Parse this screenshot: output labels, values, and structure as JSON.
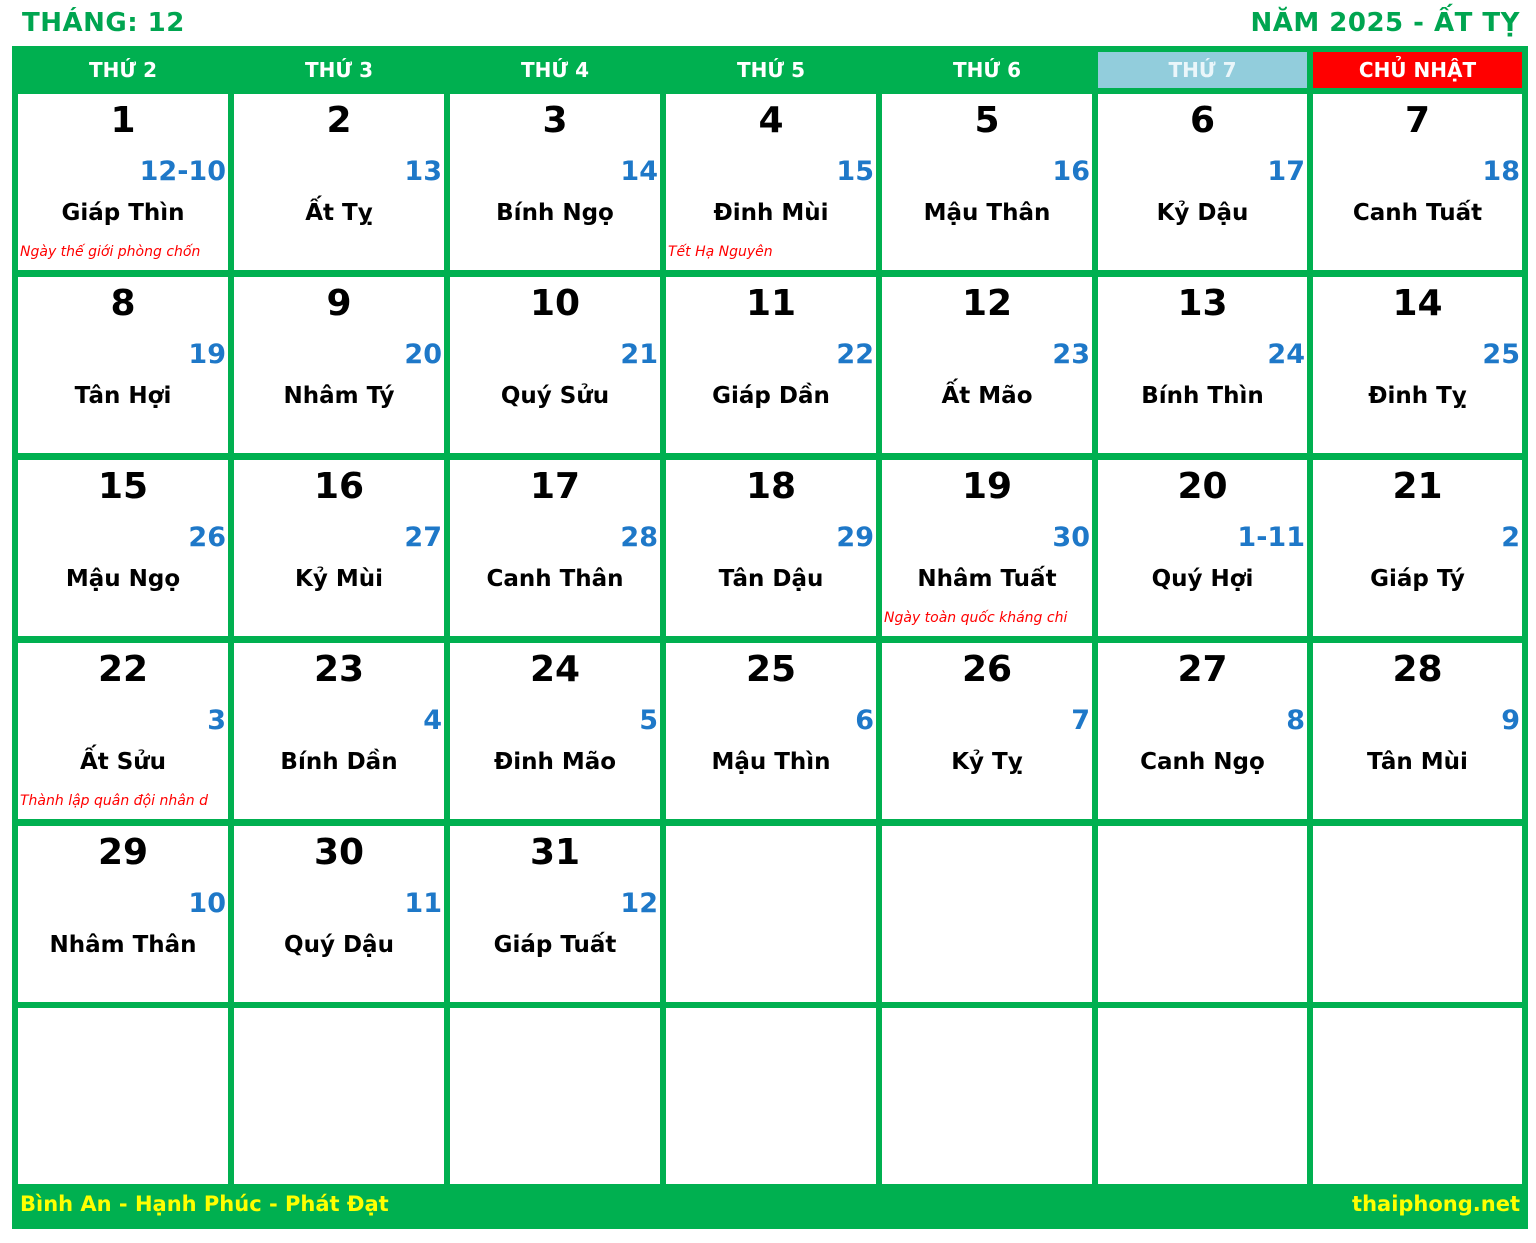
{
  "header": {
    "month_title": "THÁNG: 12",
    "year_title": "NĂM 2025 - ẤT TỴ"
  },
  "weekdays": [
    {
      "label": "THỨ 2",
      "type": "weekday"
    },
    {
      "label": "THỨ 3",
      "type": "weekday"
    },
    {
      "label": "THỨ 4",
      "type": "weekday"
    },
    {
      "label": "THỨ 5",
      "type": "weekday"
    },
    {
      "label": "THỨ 6",
      "type": "weekday"
    },
    {
      "label": "THỨ 7",
      "type": "sat"
    },
    {
      "label": "CHỦ NHẬT",
      "type": "sun"
    }
  ],
  "colors": {
    "frame": "#00b050",
    "title": "#00a550",
    "saturday_header": "#92cddc",
    "sunday_header": "#ff0000",
    "lunar_day": "#1e78c8",
    "event": "#ff0000",
    "footer_text": "#ffff00"
  },
  "days": [
    {
      "day": "1",
      "lunar": "12-10",
      "canchi": "Giáp Thìn",
      "event": "Ngày thế giới phòng chốn"
    },
    {
      "day": "2",
      "lunar": "13",
      "canchi": "Ất Tỵ",
      "event": ""
    },
    {
      "day": "3",
      "lunar": "14",
      "canchi": "Bính Ngọ",
      "event": ""
    },
    {
      "day": "4",
      "lunar": "15",
      "canchi": "Đinh Mùi",
      "event": "Tết Hạ Nguyên"
    },
    {
      "day": "5",
      "lunar": "16",
      "canchi": "Mậu Thân",
      "event": ""
    },
    {
      "day": "6",
      "lunar": "17",
      "canchi": "Kỷ Dậu",
      "event": ""
    },
    {
      "day": "7",
      "lunar": "18",
      "canchi": "Canh Tuất",
      "event": ""
    },
    {
      "day": "8",
      "lunar": "19",
      "canchi": "Tân Hợi",
      "event": ""
    },
    {
      "day": "9",
      "lunar": "20",
      "canchi": "Nhâm Tý",
      "event": ""
    },
    {
      "day": "10",
      "lunar": "21",
      "canchi": "Quý Sửu",
      "event": ""
    },
    {
      "day": "11",
      "lunar": "22",
      "canchi": "Giáp Dần",
      "event": ""
    },
    {
      "day": "12",
      "lunar": "23",
      "canchi": "Ất Mão",
      "event": ""
    },
    {
      "day": "13",
      "lunar": "24",
      "canchi": "Bính Thìn",
      "event": ""
    },
    {
      "day": "14",
      "lunar": "25",
      "canchi": "Đinh Tỵ",
      "event": ""
    },
    {
      "day": "15",
      "lunar": "26",
      "canchi": "Mậu Ngọ",
      "event": ""
    },
    {
      "day": "16",
      "lunar": "27",
      "canchi": "Kỷ Mùi",
      "event": ""
    },
    {
      "day": "17",
      "lunar": "28",
      "canchi": "Canh Thân",
      "event": ""
    },
    {
      "day": "18",
      "lunar": "29",
      "canchi": "Tân Dậu",
      "event": ""
    },
    {
      "day": "19",
      "lunar": "30",
      "canchi": "Nhâm Tuất",
      "event": "Ngày toàn quốc kháng chi"
    },
    {
      "day": "20",
      "lunar": "1-11",
      "canchi": "Quý Hợi",
      "event": ""
    },
    {
      "day": "21",
      "lunar": "2",
      "canchi": "Giáp Tý",
      "event": ""
    },
    {
      "day": "22",
      "lunar": "3",
      "canchi": "Ất Sửu",
      "event": "Thành lập quân đội nhân d"
    },
    {
      "day": "23",
      "lunar": "4",
      "canchi": "Bính Dần",
      "event": ""
    },
    {
      "day": "24",
      "lunar": "5",
      "canchi": "Đinh Mão",
      "event": ""
    },
    {
      "day": "25",
      "lunar": "6",
      "canchi": "Mậu Thìn",
      "event": ""
    },
    {
      "day": "26",
      "lunar": "7",
      "canchi": "Kỷ Tỵ",
      "event": ""
    },
    {
      "day": "27",
      "lunar": "8",
      "canchi": "Canh Ngọ",
      "event": ""
    },
    {
      "day": "28",
      "lunar": "9",
      "canchi": "Tân Mùi",
      "event": ""
    },
    {
      "day": "29",
      "lunar": "10",
      "canchi": "Nhâm Thân",
      "event": ""
    },
    {
      "day": "30",
      "lunar": "11",
      "canchi": "Quý Dậu",
      "event": ""
    },
    {
      "day": "31",
      "lunar": "12",
      "canchi": "Giáp Tuất",
      "event": ""
    }
  ],
  "footer": {
    "slogan": "Bình An - Hạnh Phúc - Phát Đạt",
    "website": "thaiphong.net"
  }
}
